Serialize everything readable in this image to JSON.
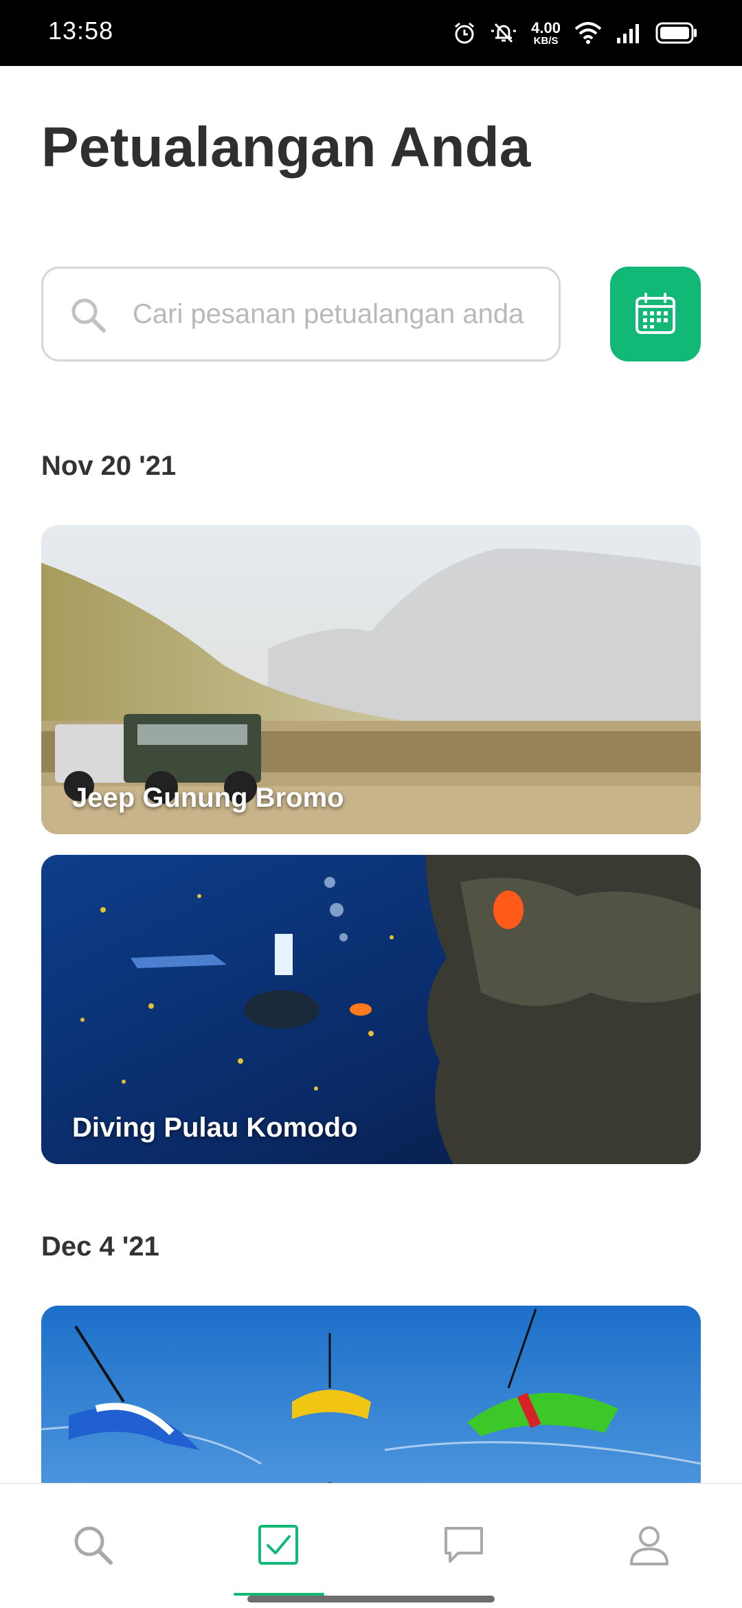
{
  "status_bar": {
    "time": "13:58",
    "net_speed_value": "4.00",
    "net_speed_unit": "KB/S",
    "icons": [
      "alarm-icon",
      "muted-bell-icon",
      "wifi-icon",
      "signal-icon",
      "battery-icon"
    ]
  },
  "header": {
    "title": "Petualangan Anda"
  },
  "search": {
    "placeholder": "Cari pesanan petualangan anda",
    "value": ""
  },
  "calendar_button": {
    "icon": "calendar-icon",
    "color": "#11b876"
  },
  "sections": [
    {
      "date": "Nov 20 '21",
      "cards": [
        {
          "title": "Jeep Gunung Bromo"
        },
        {
          "title": "Diving Pulau Komodo"
        }
      ]
    },
    {
      "date": "Dec 4 '21",
      "cards": [
        {
          "title": ""
        }
      ]
    }
  ],
  "bottom_nav": {
    "items": [
      {
        "icon": "search-icon",
        "active": false
      },
      {
        "icon": "checkbox-icon",
        "active": true
      },
      {
        "icon": "chat-icon",
        "active": false
      },
      {
        "icon": "profile-icon",
        "active": false
      }
    ],
    "accent": "#11b876",
    "inactive": "#a9a9a9"
  }
}
